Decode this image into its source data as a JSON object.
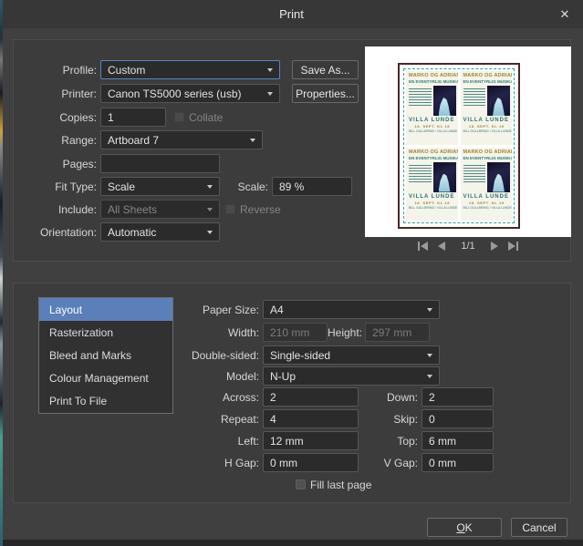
{
  "window": {
    "title": "Print",
    "close_icon": "✕"
  },
  "colors": {
    "accent_blue": "#5b7fb8",
    "focus_border": "#5585c6",
    "panel": "#3c3c3c",
    "input_bg": "#2b2b2b",
    "poster_gold": "#9b8530",
    "poster_teal": "#2d7c74"
  },
  "print_settings": {
    "profile": {
      "label": "Profile:",
      "value": "Custom"
    },
    "save_as_button": "Save As...",
    "printer": {
      "label": "Printer:",
      "value": "Canon TS5000 series (usb)"
    },
    "properties_button": "Properties...",
    "copies": {
      "label": "Copies:",
      "value": "1"
    },
    "collate": {
      "label": "Collate",
      "checked": false,
      "disabled": true
    },
    "range": {
      "label": "Range:",
      "value": "Artboard 7"
    },
    "pages": {
      "label": "Pages:",
      "value": ""
    },
    "fit_type": {
      "label": "Fit Type:",
      "value": "Scale"
    },
    "scale": {
      "label": "Scale:",
      "value": "89 %"
    },
    "include": {
      "label": "Include:",
      "value": "All Sheets",
      "disabled": true
    },
    "reverse": {
      "label": "Reverse",
      "checked": false,
      "disabled": true
    },
    "orientation": {
      "label": "Orientation:",
      "value": "Automatic"
    }
  },
  "preview": {
    "page_indicator": "1/1",
    "poster": {
      "title": "MARKO OG ADRIANE",
      "subtitle": "EN EVENTYRLIG MUSIKAL",
      "venue": "VILLA LUNDE",
      "date": "18. SEPT. KL 19",
      "tickets": "BILL GULLBRING / VILLA LUNDE"
    }
  },
  "sections": {
    "items": [
      "Layout",
      "Rasterization",
      "Bleed and Marks",
      "Colour Management",
      "Print To File"
    ],
    "selected": "Layout"
  },
  "layout_panel": {
    "paper_size": {
      "label": "Paper Size:",
      "value": "A4"
    },
    "width": {
      "label": "Width:",
      "value": "210 mm",
      "disabled": true
    },
    "height": {
      "label": "Height:",
      "value": "297 mm",
      "disabled": true
    },
    "double_sided": {
      "label": "Double-sided:",
      "value": "Single-sided"
    },
    "model": {
      "label": "Model:",
      "value": "N-Up"
    },
    "across": {
      "label": "Across:",
      "value": "2"
    },
    "down": {
      "label": "Down:",
      "value": "2"
    },
    "repeat": {
      "label": "Repeat:",
      "value": "4"
    },
    "skip": {
      "label": "Skip:",
      "value": "0"
    },
    "left": {
      "label": "Left:",
      "value": "12 mm"
    },
    "top": {
      "label": "Top:",
      "value": "6 mm"
    },
    "h_gap": {
      "label": "H Gap:",
      "value": "0 mm"
    },
    "v_gap": {
      "label": "V Gap:",
      "value": "0 mm"
    },
    "fill_last_page": {
      "label": "Fill last page",
      "checked": false
    }
  },
  "footer": {
    "ok_underlined": "O",
    "ok_rest": "K",
    "cancel_label": "Cancel"
  }
}
